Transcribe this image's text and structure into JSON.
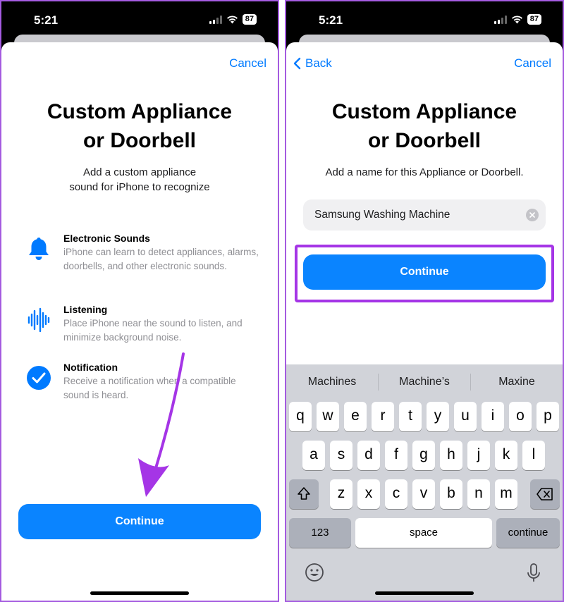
{
  "status": {
    "time": "5:21",
    "battery": "87"
  },
  "left": {
    "cancel_label": "Cancel",
    "title_line1": "Custom Appliance",
    "title_line2": "or Doorbell",
    "subtitle_line1": "Add a custom appliance",
    "subtitle_line2": "sound for iPhone to recognize",
    "features": [
      {
        "icon": "bell-icon",
        "title": "Electronic Sounds",
        "desc": "iPhone can learn to detect appliances, alarms, doorbells, and other electronic sounds."
      },
      {
        "icon": "waveform-icon",
        "title": "Listening",
        "desc": "Place iPhone near the sound to listen, and minimize background noise."
      },
      {
        "icon": "checkmark-circle-icon",
        "title": "Notification",
        "desc": "Receive a notification when a compatible sound is heard."
      }
    ],
    "continue_label": "Continue"
  },
  "right": {
    "back_label": "Back",
    "cancel_label": "Cancel",
    "title_line1": "Custom Appliance",
    "title_line2": "or Doorbell",
    "subtitle": "Add a name for this Appliance or Doorbell.",
    "name_value": "Samsung Washing Machine",
    "continue_label": "Continue",
    "keyboard": {
      "suggestions": [
        "Machines",
        "Machine’s",
        "Maxine"
      ],
      "row1": [
        "q",
        "w",
        "e",
        "r",
        "t",
        "y",
        "u",
        "i",
        "o",
        "p"
      ],
      "row2": [
        "a",
        "s",
        "d",
        "f",
        "g",
        "h",
        "j",
        "k",
        "l"
      ],
      "row3": [
        "z",
        "x",
        "c",
        "v",
        "b",
        "n",
        "m"
      ],
      "numbers_label": "123",
      "space_label": "space",
      "return_label": "continue"
    }
  },
  "colors": {
    "accent": "#007aff",
    "button": "#0a84ff",
    "highlight": "#a535e6",
    "arrow": "#a535e6"
  }
}
